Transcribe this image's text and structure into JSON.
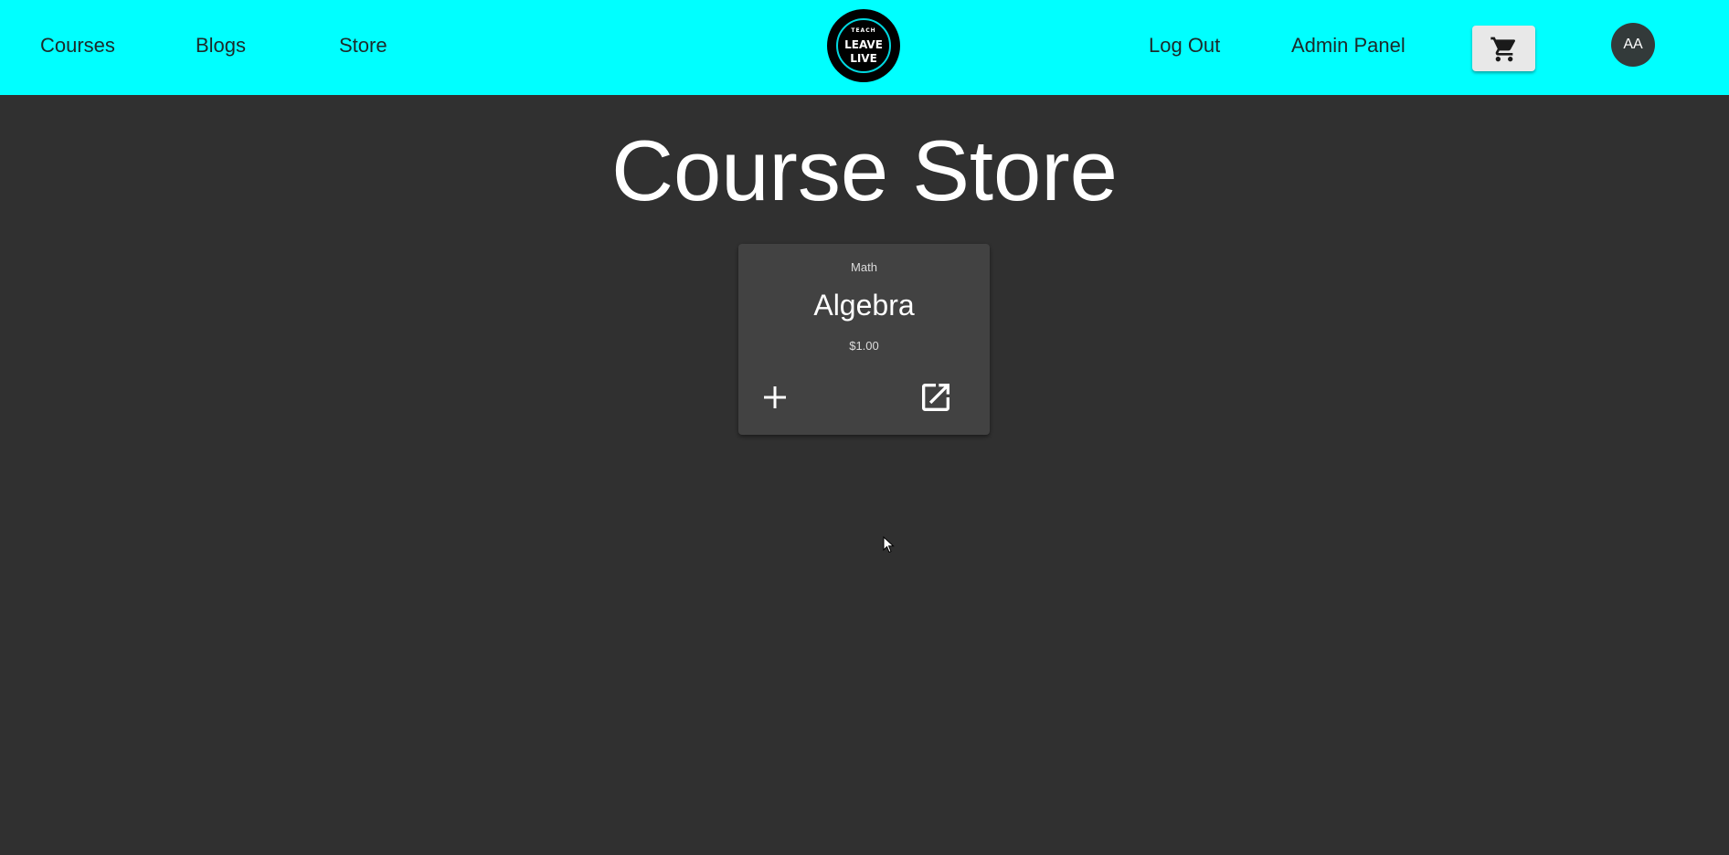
{
  "nav": {
    "courses": "Courses",
    "blogs": "Blogs",
    "store": "Store",
    "logout": "Log Out",
    "admin_panel": "Admin Panel"
  },
  "logo": {
    "line1": "TEACH",
    "line2": "LEAVE",
    "line3": "LIVE"
  },
  "cart": {
    "icon": "shopping-cart-icon"
  },
  "avatar": {
    "initials": "AA"
  },
  "page": {
    "title": "Course Store"
  },
  "courses": [
    {
      "category": "Math",
      "title": "Algebra",
      "price": "$1.00",
      "add_icon": "plus-icon",
      "open_icon": "open-in-new-icon"
    }
  ],
  "colors": {
    "header_bg": "#00ffff",
    "page_bg": "#303030",
    "card_bg": "#424242"
  }
}
